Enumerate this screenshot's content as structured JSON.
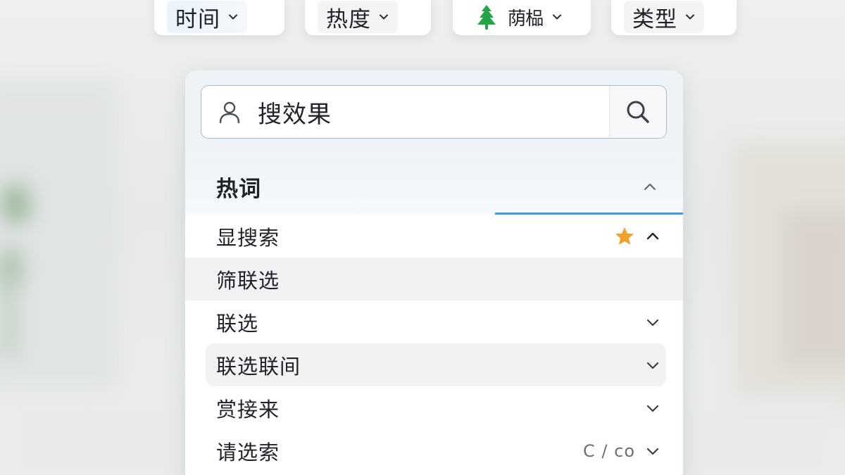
{
  "filters": [
    {
      "label": "时间",
      "icon": "chevron-down-icon"
    },
    {
      "label": "热度",
      "icon": "chevron-down-icon"
    },
    {
      "label": "荫榀",
      "icon": "tree-icon",
      "accent": "#22a645"
    },
    {
      "label": "类型",
      "icon": "chevron-down-icon"
    }
  ],
  "search": {
    "value": "搜效果",
    "leading_icon": "user-icon",
    "button_icon": "search-icon",
    "border_color": "#a9bccb"
  },
  "list": {
    "header": {
      "title": "热词",
      "icon": "chevron-up-icon",
      "underline_color": "#3a9ee3"
    },
    "items": [
      {
        "label": "显搜索",
        "icons": [
          "star-icon",
          "chevron-up-icon"
        ],
        "star_color": "#f0a32b"
      },
      {
        "label": "筛联选",
        "icons": []
      },
      {
        "label": "联选",
        "icons": [
          "chevron-down-icon"
        ]
      },
      {
        "label": "联选联间",
        "icons": [
          "chevron-down-icon"
        ]
      },
      {
        "label": "赏接来",
        "icons": [
          "chevron-down-icon"
        ]
      },
      {
        "label": "请选索",
        "shortcut": "C / co",
        "icons": [
          "chevron-down-icon"
        ]
      }
    ]
  }
}
